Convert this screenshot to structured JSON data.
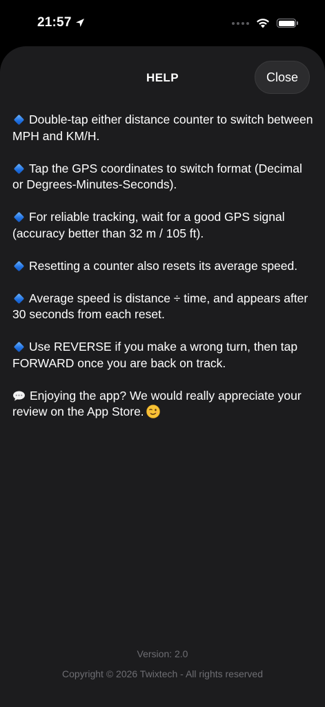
{
  "status_bar": {
    "time": "21:57"
  },
  "sheet": {
    "title": "HELP",
    "close_label": "Close"
  },
  "help_items": [
    {
      "icon": "blue-diamond-icon",
      "text": "Double-tap either distance counter to switch between MPH and KM/H."
    },
    {
      "icon": "blue-diamond-icon",
      "text": "Tap the GPS coordinates to switch format (Decimal or Degrees-Minutes-Seconds)."
    },
    {
      "icon": "blue-diamond-icon",
      "text": "For reliable tracking, wait for a good GPS signal (accuracy better than 32 m / 105 ft)."
    },
    {
      "icon": "blue-diamond-icon",
      "text": "Resetting a counter also resets its average speed."
    },
    {
      "icon": "blue-diamond-icon",
      "text": "Average speed is distance ÷ time, and appears after 30 seconds from each reset."
    },
    {
      "icon": "blue-diamond-icon",
      "text": "Use REVERSE if you make a wrong turn, then tap FORWARD once you are back on track."
    },
    {
      "icon": "speech-bubble-icon",
      "text": "Enjoying the app? We would really appreciate your review on the App Store.",
      "trailing_icon": "winking-face-icon"
    }
  ],
  "footer": {
    "version": "Version: 2.0",
    "copyright": "Copyright © 2026 Twixtech - All rights reserved"
  },
  "colors": {
    "background": "#000000",
    "sheet": "#1c1c1e",
    "accent_diamond": "#1e6fe0",
    "footer_text": "#6e6e73"
  }
}
